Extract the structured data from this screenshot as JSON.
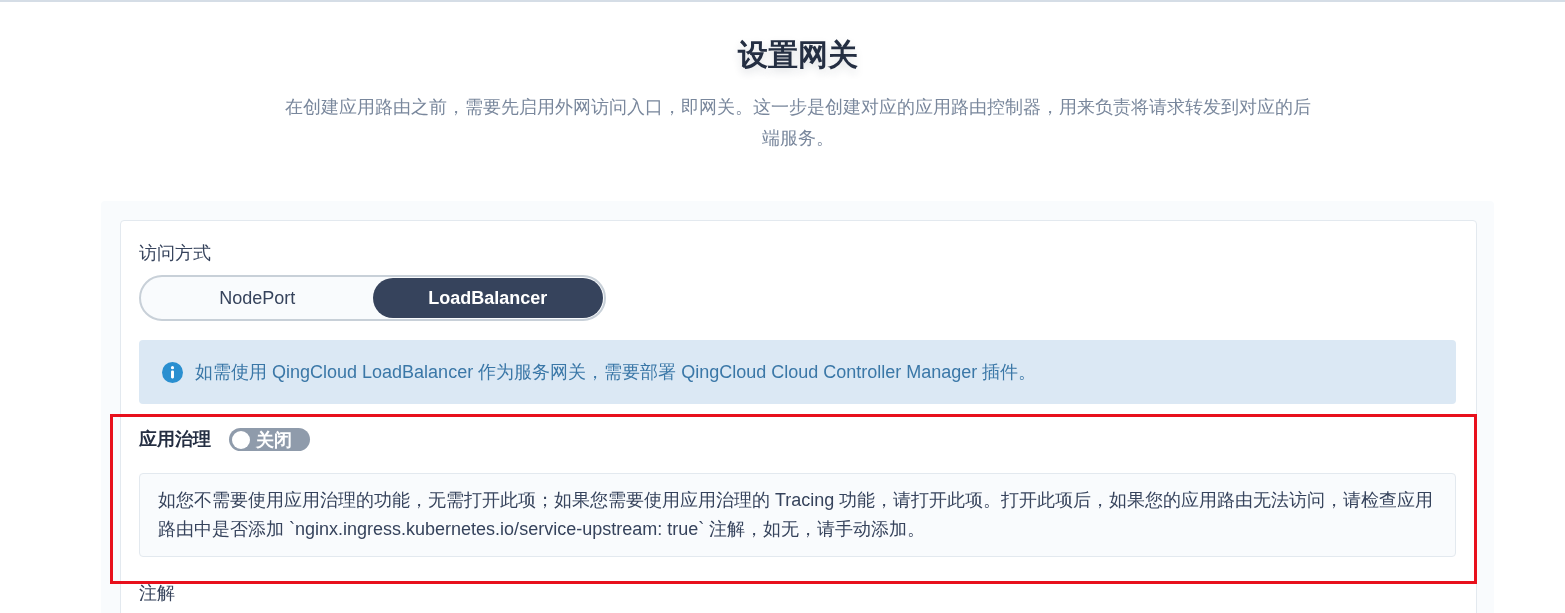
{
  "page": {
    "title": "设置网关",
    "description": "在创建应用路由之前，需要先启用外网访问入口，即网关。这一步是创建对应的应用路由控制器，用来负责将请求转发到对应的后端服务。"
  },
  "form": {
    "access_method": {
      "label": "访问方式",
      "options": [
        {
          "label": "NodePort",
          "selected": false
        },
        {
          "label": "LoadBalancer",
          "selected": true
        }
      ]
    },
    "notice": {
      "text": "如需使用 QingCloud LoadBalancer 作为服务网关，需要部署 QingCloud Cloud Controller Manager 插件。"
    },
    "service_governance": {
      "label": "应用治理",
      "highlighted": true,
      "toggle": {
        "on": false,
        "label": "关闭"
      },
      "hint": "如您不需要使用应用治理的功能，无需打开此项；如果您需要使用应用治理的 Tracing 功能，请打开此项。打开此项后，如果您的应用路由无法访问，请检查应用路由中是否添加 `nginx.ingress.kubernetes.io/service-upstream: true` 注解，如无，请手动添加。"
    },
    "annotations": {
      "label": "注解"
    }
  }
}
